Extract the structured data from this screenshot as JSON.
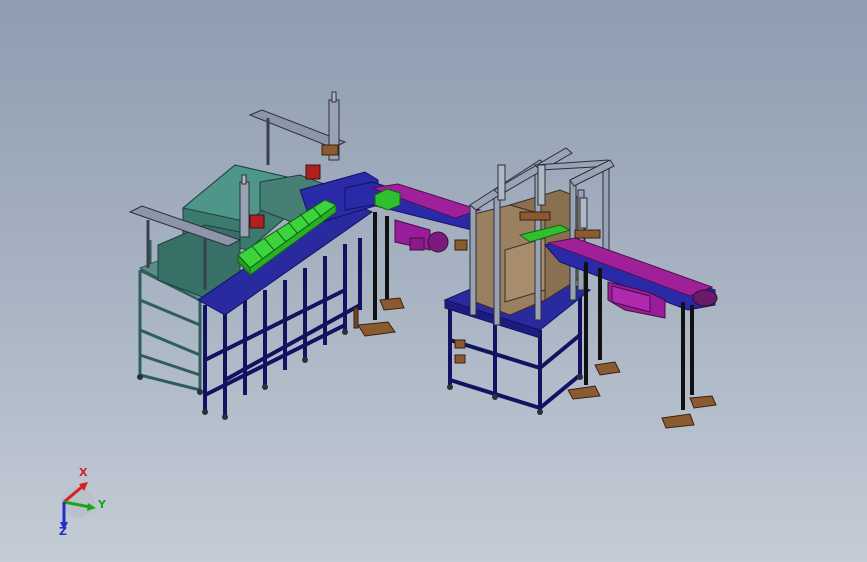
{
  "viewport": {
    "background_top": "#8e9db1",
    "background_bottom": "#c4ccd6"
  },
  "triad": {
    "x_label": "X",
    "y_label": "Y",
    "z_label": "Z",
    "x_color": "#d42020",
    "y_color": "#1aa61a",
    "z_color": "#2030c8"
  },
  "model_colors": {
    "frame_blue": "#20208f",
    "frame_teal": "#3f7c76",
    "hopper_teal": "#3c7a70",
    "upright_gray": "#9aa3b3",
    "belt_magenta": "#a0209a",
    "product_green": "#2fbf2f",
    "bracket_brown": "#8a5a30",
    "housing_tan": "#9a8060",
    "motor_purple": "#9a1c9a",
    "leg_black": "#1a1a1a"
  }
}
